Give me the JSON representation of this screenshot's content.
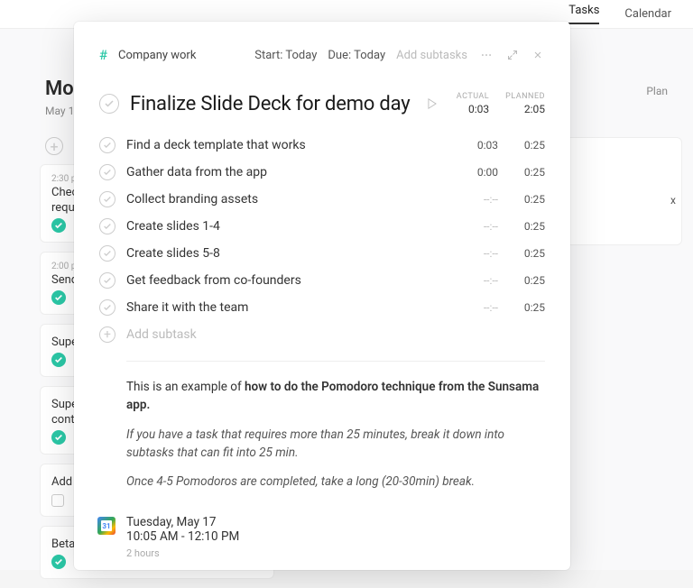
{
  "background": {
    "tabs": {
      "tasks": "Tasks",
      "calendar": "Calendar"
    },
    "day_title_partial": "Mo",
    "day_subtitle_partial": "May 1",
    "plan": "Plan",
    "right_letter": "x",
    "cards": [
      {
        "time": "2:30 p",
        "title_a": "Chec",
        "title_b": "reque"
      },
      {
        "time": "2:00 p",
        "title_a": "Send",
        "title_b": ""
      },
      {
        "time": "",
        "title_a": "Supe",
        "title_b": ""
      },
      {
        "time": "",
        "title_a": "Supe",
        "title_b": "conte"
      },
      {
        "time": "",
        "title_a": "Add",
        "title_b": "",
        "grey": true
      },
      {
        "time": "",
        "title_a": "Beta",
        "title_b": ""
      }
    ]
  },
  "modal": {
    "channel": "Company work",
    "start": "Start: Today",
    "due": "Due: Today",
    "add_subtasks": "Add subtasks",
    "title": "Finalize Slide Deck for demo day",
    "stat_labels": {
      "actual": "ACTUAL",
      "planned": "PLANNED"
    },
    "stat_values": {
      "actual": "0:03",
      "planned": "2:05"
    },
    "subtasks": [
      {
        "label": "Find a deck template that works",
        "actual": "0:03",
        "planned": "0:25"
      },
      {
        "label": "Gather data from the app",
        "actual": "0:00",
        "planned": "0:25"
      },
      {
        "label": "Collect branding assets",
        "actual": "--:--",
        "planned": "0:25"
      },
      {
        "label": "Create slides 1-4",
        "actual": "--:--",
        "planned": "0:25"
      },
      {
        "label": "Create slides 5-8",
        "actual": "--:--",
        "planned": "0:25"
      },
      {
        "label": "Get feedback from co-founders",
        "actual": "--:--",
        "planned": "0:25"
      },
      {
        "label": "Share it with the team",
        "actual": "--:--",
        "planned": "0:25"
      }
    ],
    "add_subtask_label": "Add subtask",
    "notes": {
      "intro_a": "This is an example of ",
      "intro_b": "how to do the Pomodoro technique from the Sunsama app.",
      "line2": "If you have a task that requires more than 25 minutes, break it down into subtasks that can fit into 25 min.",
      "line3": "Once 4-5 Pomodoros are completed, take a long (20-30min) break."
    },
    "schedule": {
      "date": "Tuesday, May 17",
      "time": "10:05 AM - 12:10 PM",
      "duration": "2 hours"
    }
  }
}
